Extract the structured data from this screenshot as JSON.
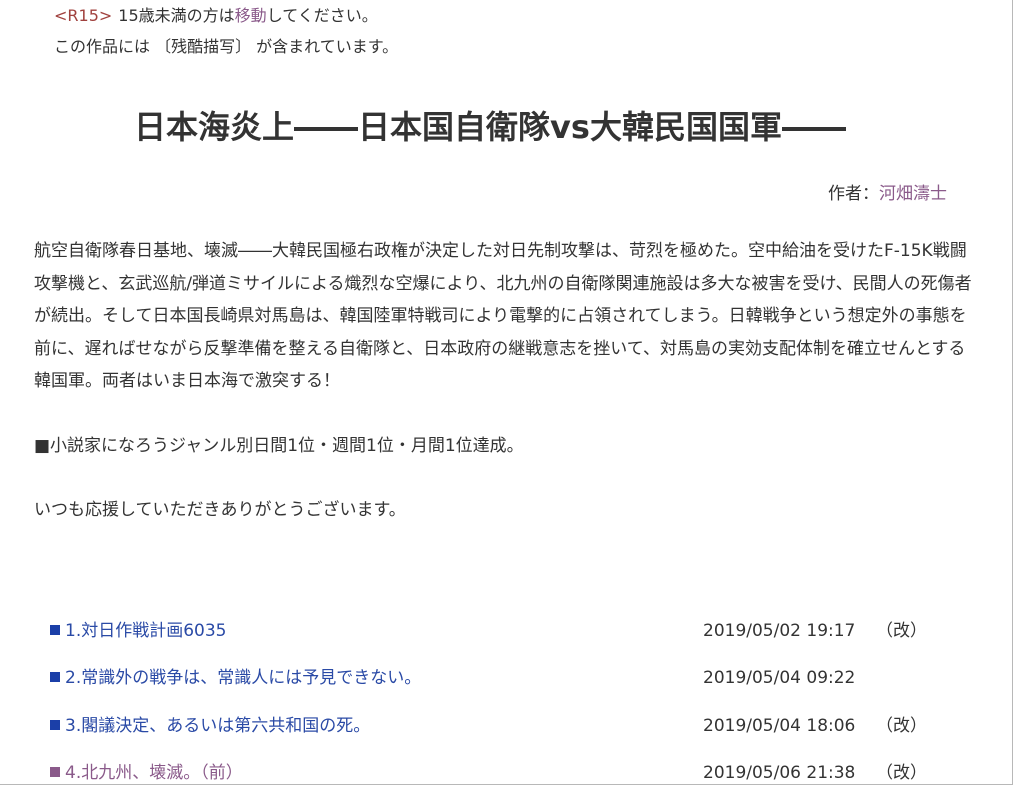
{
  "notice": {
    "rating": "<R15>",
    "age_text_before": "15歳未満の方は",
    "move_link": "移動",
    "age_text_after": "してください。",
    "content_warning": "この作品には 〔残酷描写〕 が含まれています。"
  },
  "novel": {
    "title": "日本海炎上――日本国自衛隊vs大韓民国国軍――",
    "author_label": "作者：",
    "author_name": "河畑濤士"
  },
  "synopsis": {
    "paragraph_1": "航空自衛隊春日基地、壊滅――大韓民国極右政権が決定した対日先制攻撃は、苛烈を極めた。空中給油を受けたF-15K戦闘攻撃機と、玄武巡航/弾道ミサイルによる熾烈な空爆により、北九州の自衛隊関連施設は多大な被害を受け、民間人の死傷者が続出。そして日本国長崎県対馬島は、韓国陸軍特戦司により電撃的に占領されてしまう。日韓戦争という想定外の事態を前に、遅ればせながら反撃準備を整える自衛隊と、日本政府の継戦意志を挫いて、対馬島の実効支配体制を確立せんとする韓国軍。両者はいま日本海で激突する！",
    "paragraph_2": "■小説家になろうジャンル別日間1位・週間1位・月間1位達成。",
    "paragraph_3": "いつも応援していただきありがとうございます。"
  },
  "chapters": [
    {
      "title": "1.対日作戦計画6035",
      "date": "2019/05/02 19:17",
      "revised": "（改）"
    },
    {
      "title": "2.常識外の戦争は、常識人には予見できない。",
      "date": "2019/05/04 09:22",
      "revised": ""
    },
    {
      "title": "3.閣議決定、あるいは第六共和国の死。",
      "date": "2019/05/04 18:06",
      "revised": "（改）"
    },
    {
      "title": "4.北九州、壊滅。（前）",
      "date": "2019/05/06 21:38",
      "revised": "（改）"
    }
  ],
  "colors": {
    "link": "#2a4aa6",
    "visited_link": "#8a5a8a",
    "rating": "#a0413e",
    "text": "#333333"
  }
}
